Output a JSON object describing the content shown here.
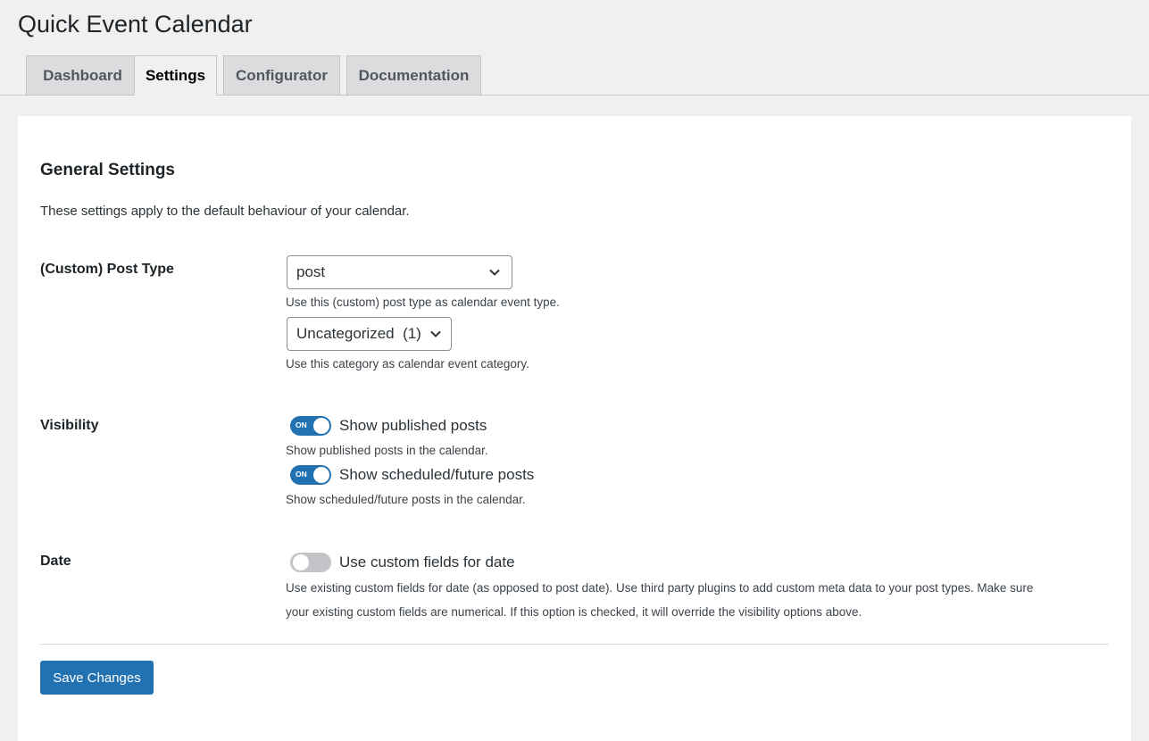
{
  "page": {
    "title": "Quick Event Calendar"
  },
  "tabs": [
    {
      "label": "Dashboard"
    },
    {
      "label": "Settings",
      "active": true
    },
    {
      "label": "Configurator"
    },
    {
      "label": "Documentation"
    }
  ],
  "general": {
    "title": "General Settings",
    "description": "These settings apply to the default behaviour of your calendar."
  },
  "post_type": {
    "label": "(Custom) Post Type",
    "type_value": "post",
    "type_hint": "Use this (custom) post type as calendar event type.",
    "category_value": "Uncategorized  (1)",
    "category_hint": "Use this category as calendar event category."
  },
  "visibility": {
    "label": "Visibility",
    "published": {
      "label": "Show published posts",
      "hint": "Show published posts in the calendar.",
      "state_text": "ON",
      "enabled": true
    },
    "scheduled": {
      "label": "Show scheduled/future posts",
      "hint": "Show scheduled/future posts in the calendar.",
      "state_text": "ON",
      "enabled": true
    }
  },
  "date": {
    "label": "Date",
    "toggle_label": "Use custom fields for date",
    "enabled": false,
    "hint_line1": "Use existing custom fields for date (as opposed to post date). Use third party plugins to add custom meta data to your post types. Make sure",
    "hint_line2": "your existing custom fields are numerical. If this option is checked, it will override the visibility options above."
  },
  "actions": {
    "save_label": "Save Changes"
  },
  "colors": {
    "accent": "#2271b1",
    "toggle_off": "#c3c4c7",
    "background": "#f0f0f1"
  },
  "icons": {
    "select_arrow": "chevron-down-icon"
  }
}
